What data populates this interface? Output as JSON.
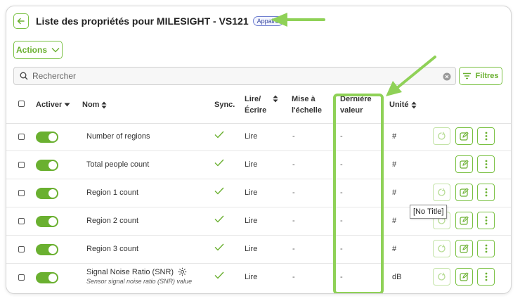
{
  "header": {
    "title": "Liste des propriétés pour MILESIGHT - VS121",
    "badge": "Appairé"
  },
  "toolbar": {
    "actions_label": "Actions",
    "filters_label": "Filtres"
  },
  "search": {
    "placeholder": "Rechercher"
  },
  "table": {
    "headers": {
      "activate": "Activer",
      "name": "Nom",
      "sync": "Sync.",
      "rw_line1": "Lire/",
      "rw_line2": "Écrire",
      "scale_line1": "Mise à",
      "scale_line2": "l'échelle",
      "last_line1": "Dernière",
      "last_line2": "valeur",
      "unit": "Unité"
    },
    "rows": [
      {
        "name": "Number of regions",
        "rw": "Lire",
        "scale": "-",
        "last": "-",
        "unit": "#"
      },
      {
        "name": "Total people count",
        "rw": "Lire",
        "scale": "-",
        "last": "-",
        "unit": "#"
      },
      {
        "name": "Region 1 count",
        "rw": "Lire",
        "scale": "-",
        "last": "-",
        "unit": "#"
      },
      {
        "name": "Region 2 count",
        "rw": "Lire",
        "scale": "-",
        "last": "-",
        "unit": "#"
      },
      {
        "name": "Region 3 count",
        "rw": "Lire",
        "scale": "-",
        "last": "-",
        "unit": "#"
      },
      {
        "name": "Signal Noise Ratio (SNR)",
        "description": "Sensor signal noise ratio (SNR) value",
        "rw": "Lire",
        "scale": "-",
        "last": "-",
        "unit": "dB"
      }
    ]
  },
  "tooltip": "[No Title]",
  "colors": {
    "accent": "#6ab030",
    "highlight": "#8fd157"
  }
}
